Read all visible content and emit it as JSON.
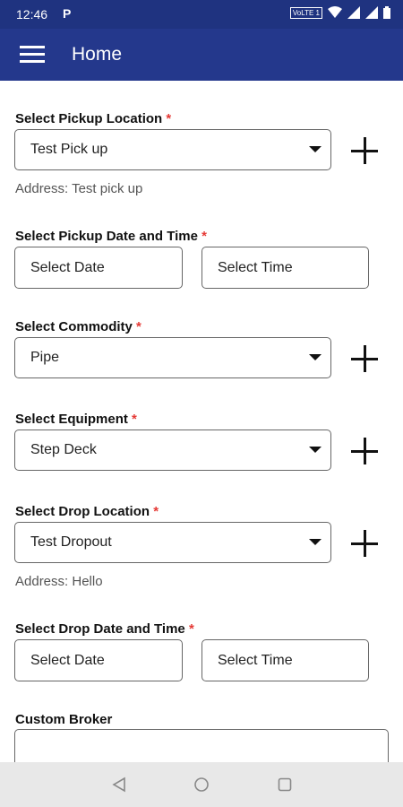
{
  "status_bar": {
    "time": "12:46",
    "notification": "P",
    "volte": "VoLTE 1"
  },
  "app_bar": {
    "title": "Home"
  },
  "form": {
    "pickup_location": {
      "label": "Select Pickup Location",
      "value": "Test Pick up",
      "address": "Address: Test pick up"
    },
    "pickup_datetime": {
      "label": "Select Pickup Date and Time",
      "date_placeholder": "Select Date",
      "time_placeholder": "Select Time"
    },
    "commodity": {
      "label": "Select Commodity",
      "value": "Pipe"
    },
    "equipment": {
      "label": "Select Equipment",
      "value": "Step Deck"
    },
    "drop_location": {
      "label": "Select Drop Location",
      "value": "Test Dropout",
      "address": "Address: Hello"
    },
    "drop_datetime": {
      "label": "Select Drop Date and Time",
      "date_placeholder": "Select Date",
      "time_placeholder": "Select Time"
    },
    "custom_broker": {
      "label": "Custom Broker",
      "value": ""
    },
    "required_mark": "*"
  },
  "colors": {
    "app_bar": "#24388c",
    "status_bar": "#1f3380",
    "required": "#e53935"
  },
  "icons": [
    "menu-icon",
    "add-icon",
    "dropdown-caret-icon",
    "back-icon",
    "home-icon",
    "recents-icon"
  ]
}
